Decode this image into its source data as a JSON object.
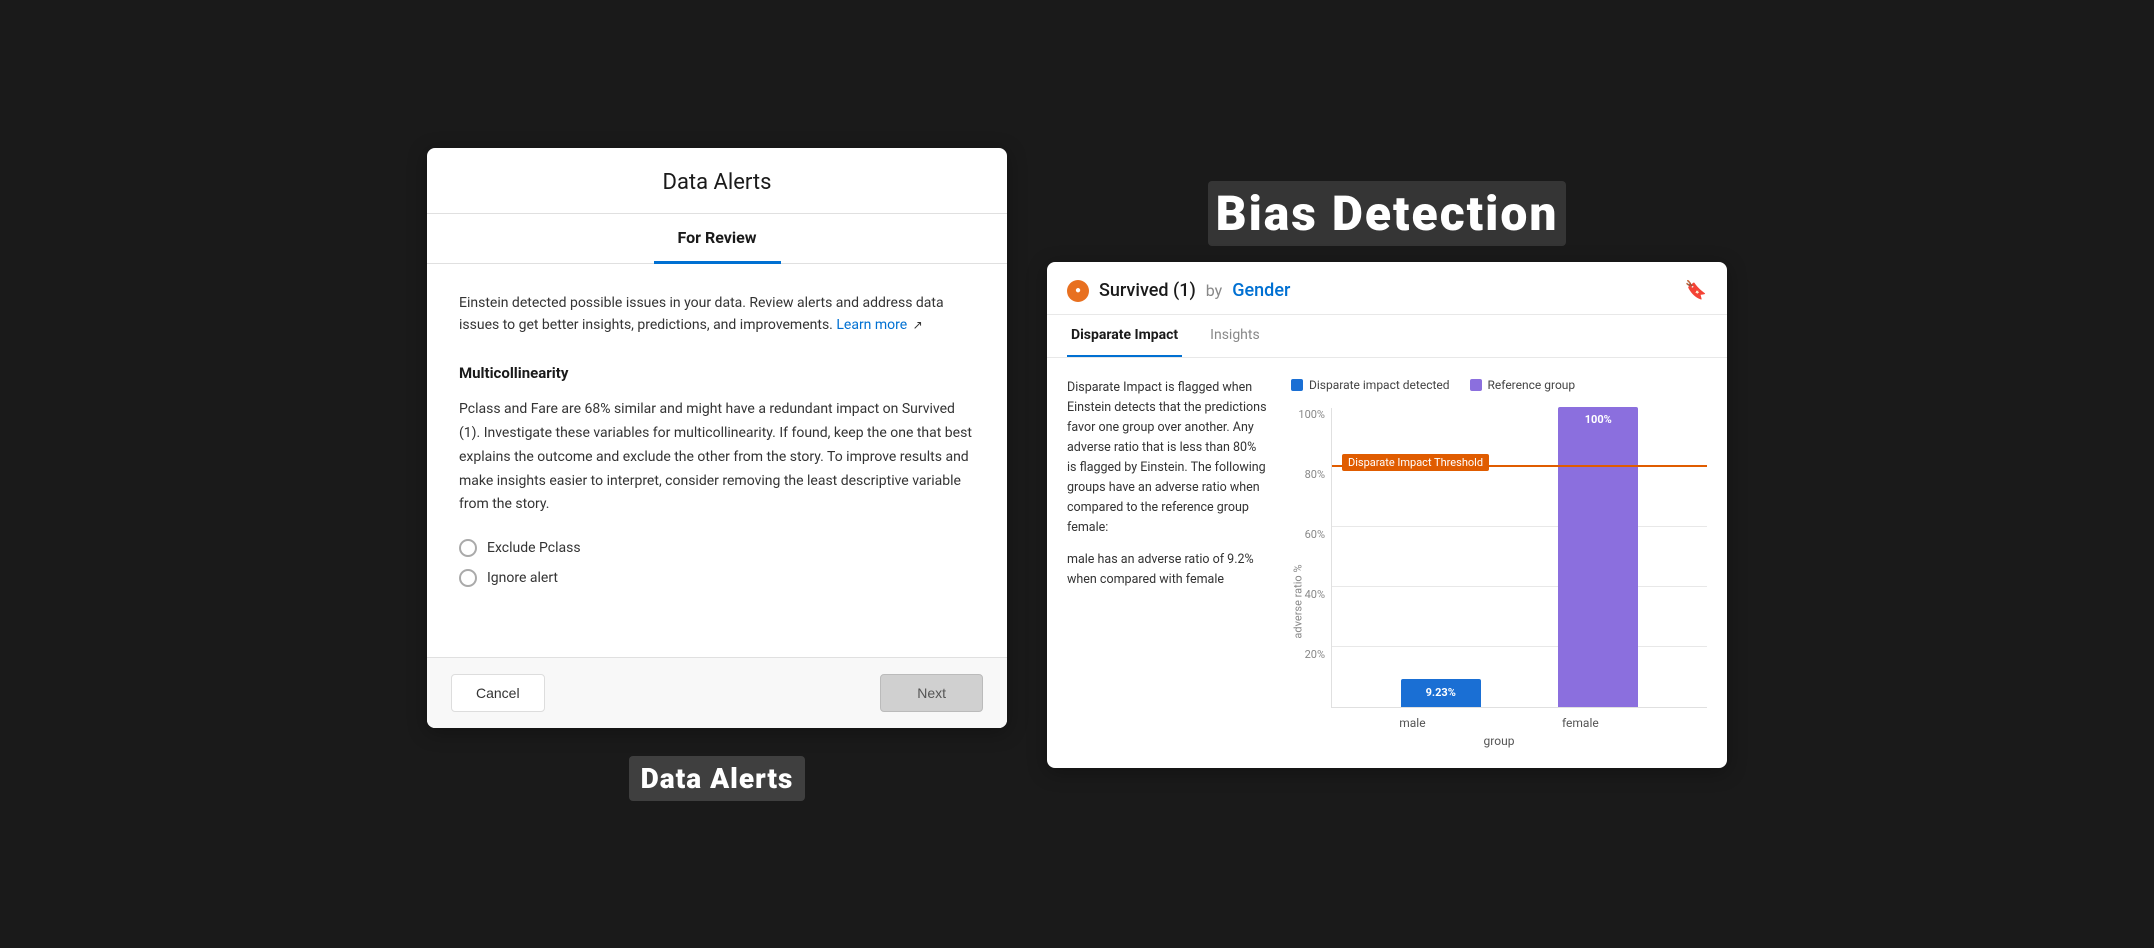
{
  "dataAlerts": {
    "title": "Data Alerts",
    "tab": "For Review",
    "introText": "Einstein detected possible issues in your data. Review alerts and address data issues to get better insights, predictions, and improvements.",
    "learnMoreLink": "Learn more",
    "sectionTitle": "Multicollinearity",
    "descriptionText": "Pclass and Fare are 68% similar and might have a redundant impact on Survived (1). Investigate these variables for multicollinearity. If found, keep the one that best explains the outcome and exclude the other from the story. To improve results and make insights easier to interpret, consider removing the least descriptive variable from the story.",
    "radioOptions": [
      "Exclude Pclass",
      "Ignore alert"
    ],
    "cancelLabel": "Cancel",
    "nextLabel": "Next",
    "bottomLabel": "Data Alerts"
  },
  "biasDetection": {
    "titleLabel": "Bias Detection",
    "chartTitle": "Survived (1) by Gender",
    "tabs": [
      "Disparate Impact",
      "Insights"
    ],
    "activeTab": "Disparate Impact",
    "description1": "Disparate Impact is flagged when Einstein detects that the predictions favor one group over another. Any adverse ratio that is less than 80% is flagged by Einstein. The following groups have an adverse ratio when compared to the reference group female:",
    "description2": "male has an adverse ratio of 9.2% when compared with female",
    "legend": {
      "disparateLabel": "Disparate impact detected",
      "referenceLabel": "Reference group"
    },
    "thresholdLabel": "Disparate Impact Threshold",
    "bars": [
      {
        "label": "male",
        "value": "9.23%",
        "heightPct": 9.23,
        "type": "blue"
      },
      {
        "label": "female",
        "value": "100%",
        "heightPct": 100,
        "type": "purple"
      }
    ],
    "yAxisLabels": [
      "100%",
      "80%",
      "60%",
      "40%",
      "20%",
      ""
    ],
    "yAxisTitle": "adverse ratio %",
    "xAxisTitle": "group"
  }
}
